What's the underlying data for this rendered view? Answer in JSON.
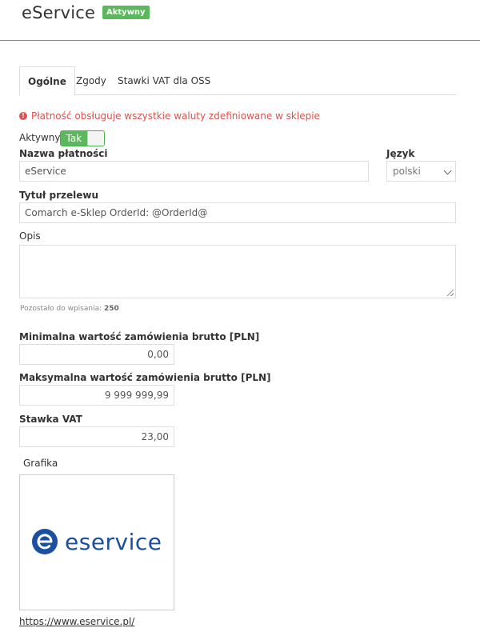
{
  "header": {
    "title": "eService",
    "status_badge": "Aktywny"
  },
  "tabs": [
    {
      "label": "Ogólne",
      "active": true
    },
    {
      "label": "Zgody",
      "active": false
    },
    {
      "label": "Stawki VAT dla OSS",
      "active": false
    }
  ],
  "alert": {
    "icon": "exclamation-circle-icon",
    "text": "Płatność obsługuje wszystkie waluty zdefiniowane w sklepie"
  },
  "active_toggle": {
    "label": "Aktywny",
    "on_text": "Tak"
  },
  "payment_name": {
    "label": "Nazwa płatności",
    "value": "eService"
  },
  "language": {
    "label": "Język",
    "selected": "polski"
  },
  "transfer_title": {
    "label": "Tytuł przelewu",
    "value": "Comarch e-Sklep OrderId: @OrderId@"
  },
  "description": {
    "label": "Opis",
    "value": "",
    "remaining_label": "Pozostało do wpisania:",
    "remaining_count": "250"
  },
  "min_order": {
    "label": "Minimalna wartość zamówienia brutto [PLN]",
    "value": "0,00"
  },
  "max_order": {
    "label": "Maksymalna wartość zamówienia brutto [PLN]",
    "value": "9 999 999,99"
  },
  "vat_rate": {
    "label": "Stawka VAT",
    "value": "23,00"
  },
  "graphic": {
    "label": "Grafika",
    "logo_text": "eservice"
  },
  "website_link": "https://www.eservice.pl/",
  "colors": {
    "success": "#5cb85c",
    "danger": "#d9534f",
    "brand_logo": "#1b4fa0"
  }
}
